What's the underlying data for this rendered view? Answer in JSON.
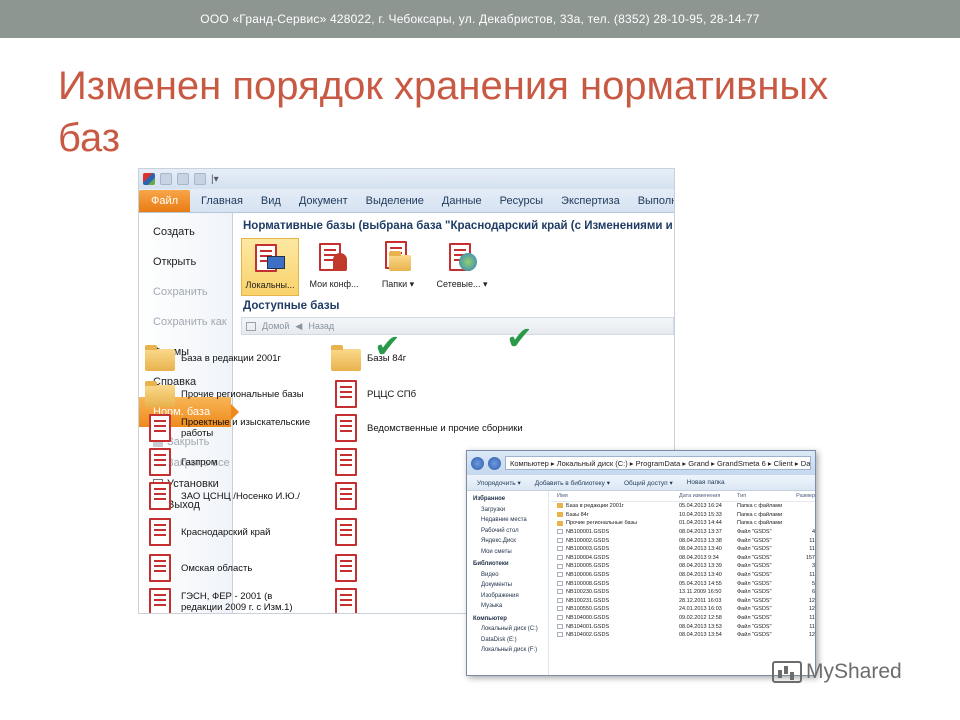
{
  "header": {
    "company": "ООО «Гранд-Сервис» 428022, г. Чебоксары, ул. Декабристов, 33а, тел. (8352) 28-10-95, 28-14-77"
  },
  "slide": {
    "title": "Изменен порядок хранения нормативных баз"
  },
  "ribbon": {
    "tabs": [
      "Файл",
      "Главная",
      "Вид",
      "Документ",
      "Выделение",
      "Данные",
      "Ресурсы",
      "Экспертиза",
      "Выполнение"
    ]
  },
  "backstage": {
    "items": [
      {
        "label": "Создать",
        "enabled": true
      },
      {
        "label": "Открыть",
        "enabled": true
      },
      {
        "label": "Сохранить",
        "enabled": false
      },
      {
        "label": "Сохранить как",
        "enabled": false
      },
      {
        "label": "Формы",
        "enabled": true
      },
      {
        "label": "Справка",
        "enabled": true
      },
      {
        "label": "Норм. база",
        "enabled": true,
        "active": true
      }
    ],
    "sub": [
      {
        "label": "Закрыть",
        "enabled": false,
        "icon": "close-icon"
      },
      {
        "label": "Закрыть все",
        "enabled": false,
        "icon": "close-all-icon"
      },
      {
        "label": "Установки",
        "enabled": true,
        "icon": "settings-icon"
      },
      {
        "label": "Выход",
        "enabled": true,
        "icon": "exit-icon"
      }
    ]
  },
  "panel": {
    "title": "Нормативные базы (выбрана база \"Краснодарский край (с Изменениями и Д",
    "buttons": [
      {
        "label": "Локальны...",
        "icon": "local-db-icon",
        "selected": true
      },
      {
        "label": "Мои конф...",
        "icon": "my-config-icon",
        "selected": false
      },
      {
        "label": "Папки",
        "icon": "folders-icon",
        "selected": false,
        "dropdown": true
      },
      {
        "label": "Сетевые...",
        "icon": "network-icon",
        "selected": false,
        "dropdown": true
      }
    ],
    "available_label": "Доступные базы",
    "nav": {
      "home": "Домой",
      "back": "Назад"
    },
    "left_column": [
      {
        "label": "База в редакции 2001г",
        "kind": "folder",
        "checked": true
      },
      {
        "label": "Прочие региональные базы",
        "kind": "folder"
      },
      {
        "label": "Проектные и изыскательские работы",
        "kind": "book"
      },
      {
        "label": "Газпром",
        "kind": "book"
      },
      {
        "label": "ЗАО ЦСНЦ /Носенко И.Ю./",
        "kind": "book"
      },
      {
        "label": "Краснодарский край",
        "kind": "book"
      },
      {
        "label": "Омская область",
        "kind": "book"
      },
      {
        "label": "ГЭСН, ФЕР - 2001 (в редакции 2009 г. с Изм.1)",
        "kind": "book"
      }
    ],
    "right_column": [
      {
        "label": "Базы 84г",
        "kind": "folder",
        "checked": true
      },
      {
        "label": "РЦЦС СПб",
        "kind": "book"
      },
      {
        "label": "Ведомственные и прочие сборники",
        "kind": "book"
      }
    ]
  },
  "explorer": {
    "path": "Компьютер ▸ Локальный диск (C:) ▸ ProgramData ▸ Grand ▸ GrandSmeta 6 ▸ Client ▸ Data ▸",
    "tools": [
      "Упорядочить ▾",
      "Добавить в библиотеку ▾",
      "Общий доступ ▾",
      "Новая папка"
    ],
    "sidebar": [
      {
        "label": "Избранное",
        "header": true
      },
      {
        "label": "Загрузки"
      },
      {
        "label": "Недавние места"
      },
      {
        "label": "Рабочий стол"
      },
      {
        "label": "Яндекс.Диск"
      },
      {
        "label": "Мои сметы"
      },
      {
        "label": "Библиотеки",
        "header": true
      },
      {
        "label": "Видео"
      },
      {
        "label": "Документы"
      },
      {
        "label": "Изображения"
      },
      {
        "label": "Музыка"
      },
      {
        "label": "Компьютер",
        "header": true
      },
      {
        "label": "Локальный диск (C:)"
      },
      {
        "label": "DataDisk (E:)"
      },
      {
        "label": "Локальный диск (F:)"
      }
    ],
    "columns": [
      "Имя",
      "Дата изменения",
      "Тип",
      "Размер"
    ],
    "rows": [
      {
        "name": "База в редакции 2001г",
        "date": "05.04.2013 16:24",
        "type": "Папка с файлами",
        "size": "",
        "folder": true
      },
      {
        "name": "Базы 84г",
        "date": "10.04.2013 15:33",
        "type": "Папка с файлами",
        "size": "",
        "folder": true
      },
      {
        "name": "Прочие региональные базы",
        "date": "01.04.2013 14:44",
        "type": "Папка с файлами",
        "size": "",
        "folder": true
      },
      {
        "name": "NB100001.GSDS",
        "date": "08.04.2013 13:37",
        "type": "Файл \"GSDS\"",
        "size": "4"
      },
      {
        "name": "NB100002.GSDS",
        "date": "08.04.2013 13:38",
        "type": "Файл \"GSDS\"",
        "size": "11"
      },
      {
        "name": "NB100003.GSDS",
        "date": "08.04.2013 13:40",
        "type": "Файл \"GSDS\"",
        "size": "11"
      },
      {
        "name": "NB100004.GSDS",
        "date": "08.04.2013 9:34",
        "type": "Файл \"GSDS\"",
        "size": "157"
      },
      {
        "name": "NB100005.GSDS",
        "date": "08.04.2013 13:39",
        "type": "Файл \"GSDS\"",
        "size": "3"
      },
      {
        "name": "NB100006.GSDS",
        "date": "08.04.2013 13:40",
        "type": "Файл \"GSDS\"",
        "size": "11"
      },
      {
        "name": "NB100008.GSDS",
        "date": "05.04.2013 14:55",
        "type": "Файл \"GSDS\"",
        "size": "5"
      },
      {
        "name": "NB100230.GSDS",
        "date": "13.11.2009 16:50",
        "type": "Файл \"GSDS\"",
        "size": "6"
      },
      {
        "name": "NB100231.GSDS",
        "date": "28.12.2011 16:03",
        "type": "Файл \"GSDS\"",
        "size": "12"
      },
      {
        "name": "NB100550.GSDS",
        "date": "24.01.2013 16:03",
        "type": "Файл \"GSDS\"",
        "size": "12"
      },
      {
        "name": "NB104000.GSDS",
        "date": "09.02.2012 12:58",
        "type": "Файл \"GSDS\"",
        "size": "11"
      },
      {
        "name": "NB104001.GSDS",
        "date": "08.04.2013 13:53",
        "type": "Файл \"GSDS\"",
        "size": "11"
      },
      {
        "name": "NB104002.GSDS",
        "date": "08.04.2013 13:54",
        "type": "Файл \"GSDS\"",
        "size": "12"
      }
    ]
  },
  "watermark": {
    "text": "MyShared"
  },
  "colors": {
    "title": "#c85a44",
    "topbar": "#8e9692",
    "accent": "#ee8a1c",
    "check": "#2a9a4a"
  }
}
